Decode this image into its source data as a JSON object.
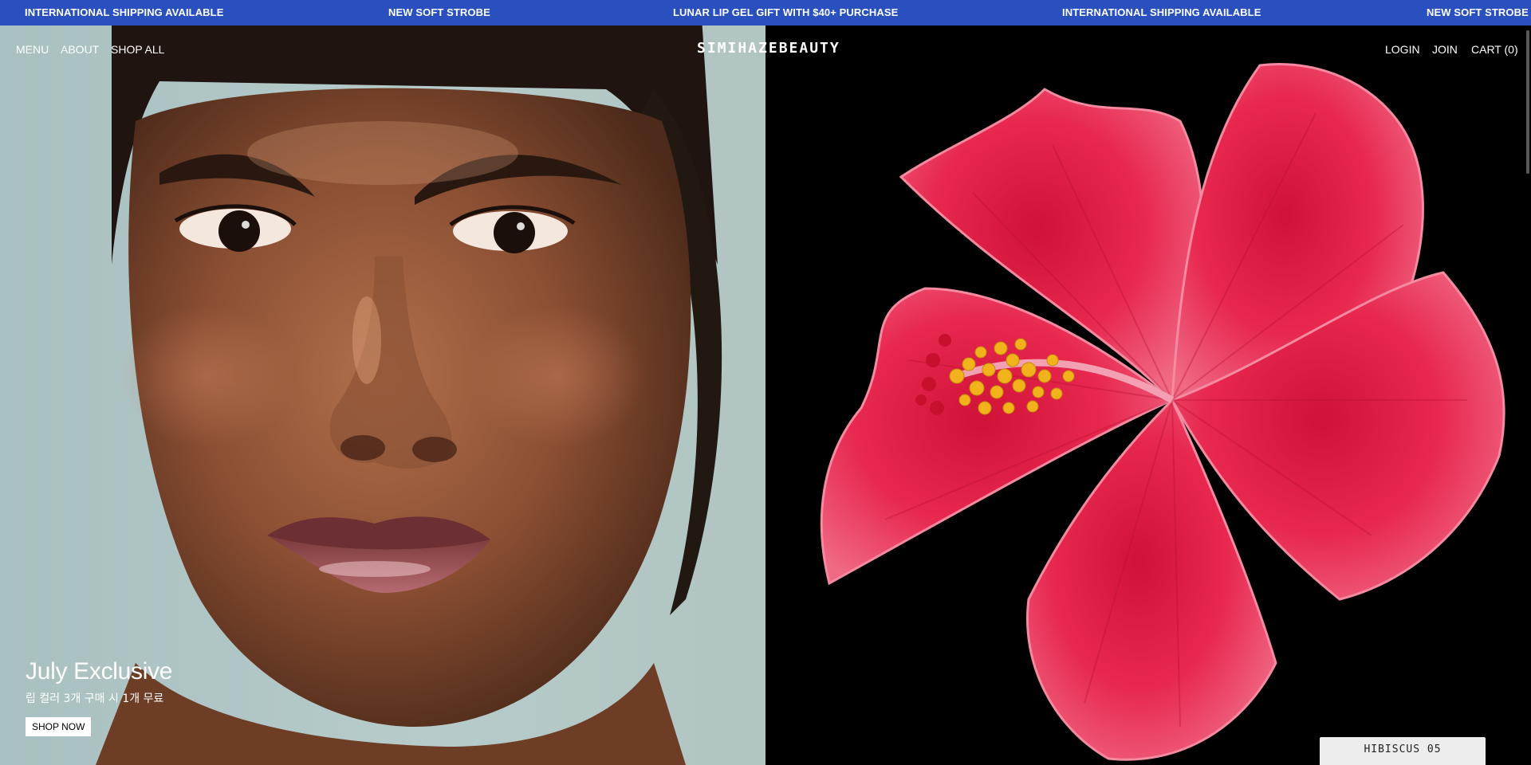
{
  "announcement_bar": {
    "background": "#2a50c0",
    "items": [
      "INTERNATIONAL SHIPPING AVAILABLE",
      "NEW SOFT STROBE",
      "LUNAR LIP GEL GIFT WITH $40+ PURCHASE",
      "INTERNATIONAL SHIPPING AVAILABLE",
      "NEW SOFT STROBE"
    ]
  },
  "header": {
    "nav_left": [
      "MENU",
      "ABOUT",
      "SHOP ALL"
    ],
    "logo": "SIMIHAZEBEAUTY",
    "nav_right": [
      "LOGIN",
      "JOIN",
      "CART (0)"
    ]
  },
  "hero": {
    "promo": {
      "title": "July Exclusive",
      "subtitle": "립 컬러 3개 구매 시 1개 무료",
      "button_label": "SHOP NOW"
    },
    "product_tag": "HIBISCUS 05",
    "colors": {
      "flower": "#e8284f",
      "stamen": "#f2b21c",
      "right_bg": "#000000",
      "left_bg": "#b4c8c7"
    }
  }
}
